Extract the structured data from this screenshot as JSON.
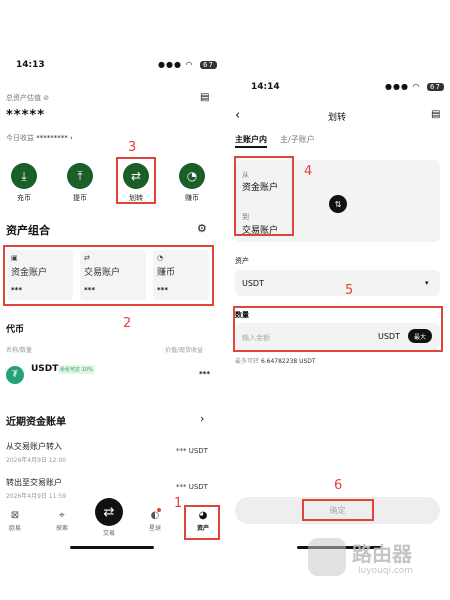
{
  "left": {
    "status_time": "14:13",
    "status_signal": "●●●",
    "status_wifi": "◠",
    "battery": "67",
    "total_label": "总资产估值",
    "total_value": "*****",
    "today_label": "今日收益",
    "today_value": "*********",
    "quick_actions": [
      {
        "label": "充币",
        "icon": "⤓"
      },
      {
        "label": "提币",
        "icon": "⤒"
      },
      {
        "label": "划转",
        "icon": "⇄"
      },
      {
        "label": "赚币",
        "icon": "◔"
      }
    ],
    "portfolio_title": "资产组合",
    "cards": [
      {
        "name": "资金账户",
        "value": "***",
        "icon": "▣"
      },
      {
        "name": "交易账户",
        "value": "***",
        "icon": "⇄"
      },
      {
        "name": "赚币",
        "value": "***",
        "icon": "◔"
      }
    ],
    "coin_section_title": "代币",
    "col_name_qty": "名称/数量",
    "col_price_pnl": "价值/现货收益",
    "coin_symbol": "USDT",
    "coin_badge": "余化可达 10%",
    "coin_value": "***",
    "recent_title": "近期资金账单",
    "bills": [
      {
        "title": "从交易账户转入",
        "date": "2026年4月9日 12:00",
        "amount": "*** USDT"
      },
      {
        "title": "转出至交易账户",
        "date": "2026年4月9日 11:59",
        "amount": "*** USDT"
      }
    ],
    "tabs": [
      {
        "label": "欧易"
      },
      {
        "label": "探索"
      },
      {
        "label": "交易"
      },
      {
        "label": "星球"
      },
      {
        "label": "资产"
      }
    ],
    "annotations": [
      "1",
      "2",
      "3"
    ]
  },
  "right": {
    "status_time": "14:14",
    "status_signal": "●●●",
    "status_wifi": "◠",
    "battery": "67",
    "title": "划转",
    "tab_main": "主账户内",
    "tab_sub": "主/子账户",
    "from_label": "从",
    "from_account": "资金账户",
    "to_label": "到",
    "to_account": "交易账户",
    "asset_label": "资产",
    "asset_value": "USDT",
    "amount_label": "数量",
    "amount_placeholder": "输入金额",
    "amount_unit": "USDT",
    "max_label": "最大",
    "available_label": "最多可转",
    "available_value": "6.64782238 USDT",
    "confirm_label": "确定",
    "annotations": [
      "4",
      "5",
      "6"
    ]
  },
  "watermark": {
    "title": "路由器",
    "domain": "luyouqi.com"
  },
  "colors": {
    "accent_green": "#1a5f2a",
    "annotation_red": "#e0443a"
  }
}
